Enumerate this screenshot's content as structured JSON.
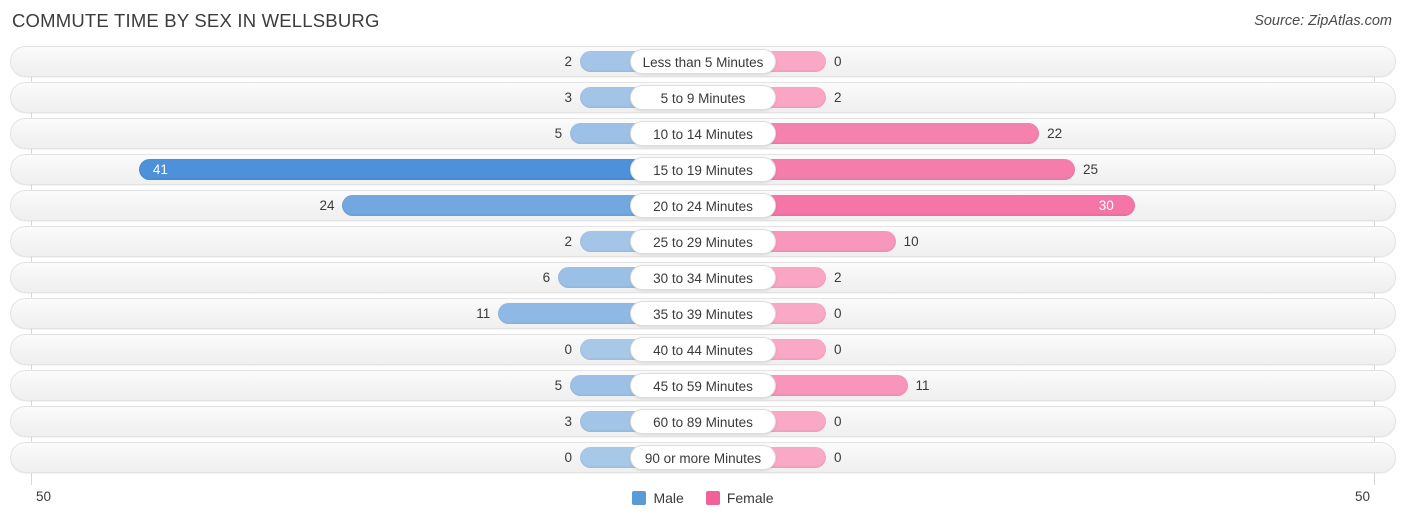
{
  "header": {
    "title": "COMMUTE TIME BY SEX IN WELLSBURG",
    "source": "Source: ZipAtlas.com"
  },
  "axis": {
    "left_tick": "50",
    "right_tick": "50",
    "max": 50
  },
  "legend": {
    "items": [
      {
        "label": "Male",
        "color": "#5b9bd5"
      },
      {
        "label": "Female",
        "color": "#f2609a"
      }
    ]
  },
  "colors": {
    "male_light": "#a8c8e8",
    "male_mid": "#8ab8e3",
    "male_strong": "#4a90d9",
    "female_light": "#f9a8c5",
    "female_mid": "#f78cb3",
    "female_strong": "#f2609a"
  },
  "chart_data": {
    "type": "bar",
    "orientation": "horizontal",
    "layout": "diverging",
    "title": "COMMUTE TIME BY SEX IN WELLSBURG",
    "xlabel": "",
    "ylabel": "",
    "xlim": [
      50,
      50
    ],
    "grid": true,
    "legend_position": "bottom-center",
    "categories": [
      "Less than 5 Minutes",
      "5 to 9 Minutes",
      "10 to 14 Minutes",
      "15 to 19 Minutes",
      "20 to 24 Minutes",
      "25 to 29 Minutes",
      "30 to 34 Minutes",
      "35 to 39 Minutes",
      "40 to 44 Minutes",
      "45 to 59 Minutes",
      "60 to 89 Minutes",
      "90 or more Minutes"
    ],
    "series": [
      {
        "name": "Male",
        "side": "left",
        "values": [
          2,
          3,
          5,
          41,
          24,
          2,
          6,
          11,
          0,
          5,
          3,
          0
        ],
        "labels": [
          "2",
          "3",
          "5",
          "41",
          "24",
          "2",
          "6",
          "11",
          "0",
          "5",
          "3",
          "0"
        ]
      },
      {
        "name": "Female",
        "side": "right",
        "values": [
          0,
          2,
          22,
          25,
          30,
          10,
          2,
          0,
          0,
          11,
          0,
          0
        ],
        "labels": [
          "0",
          "2",
          "22",
          "25",
          "30",
          "10",
          "2",
          "0",
          "0",
          "11",
          "0",
          "0"
        ]
      }
    ]
  }
}
